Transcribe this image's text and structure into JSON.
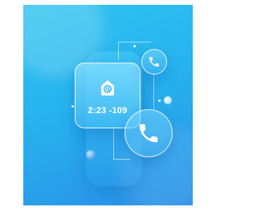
{
  "card": {
    "label": "2:23 -109"
  },
  "icons": {
    "mail": "at-sign-mail-icon",
    "call_small": "phone-icon",
    "call_large": "phone-icon"
  },
  "colors": {
    "background_top": "#2fc4f0",
    "background_bottom": "#2a8fe6",
    "foreground": "#ffffff"
  }
}
